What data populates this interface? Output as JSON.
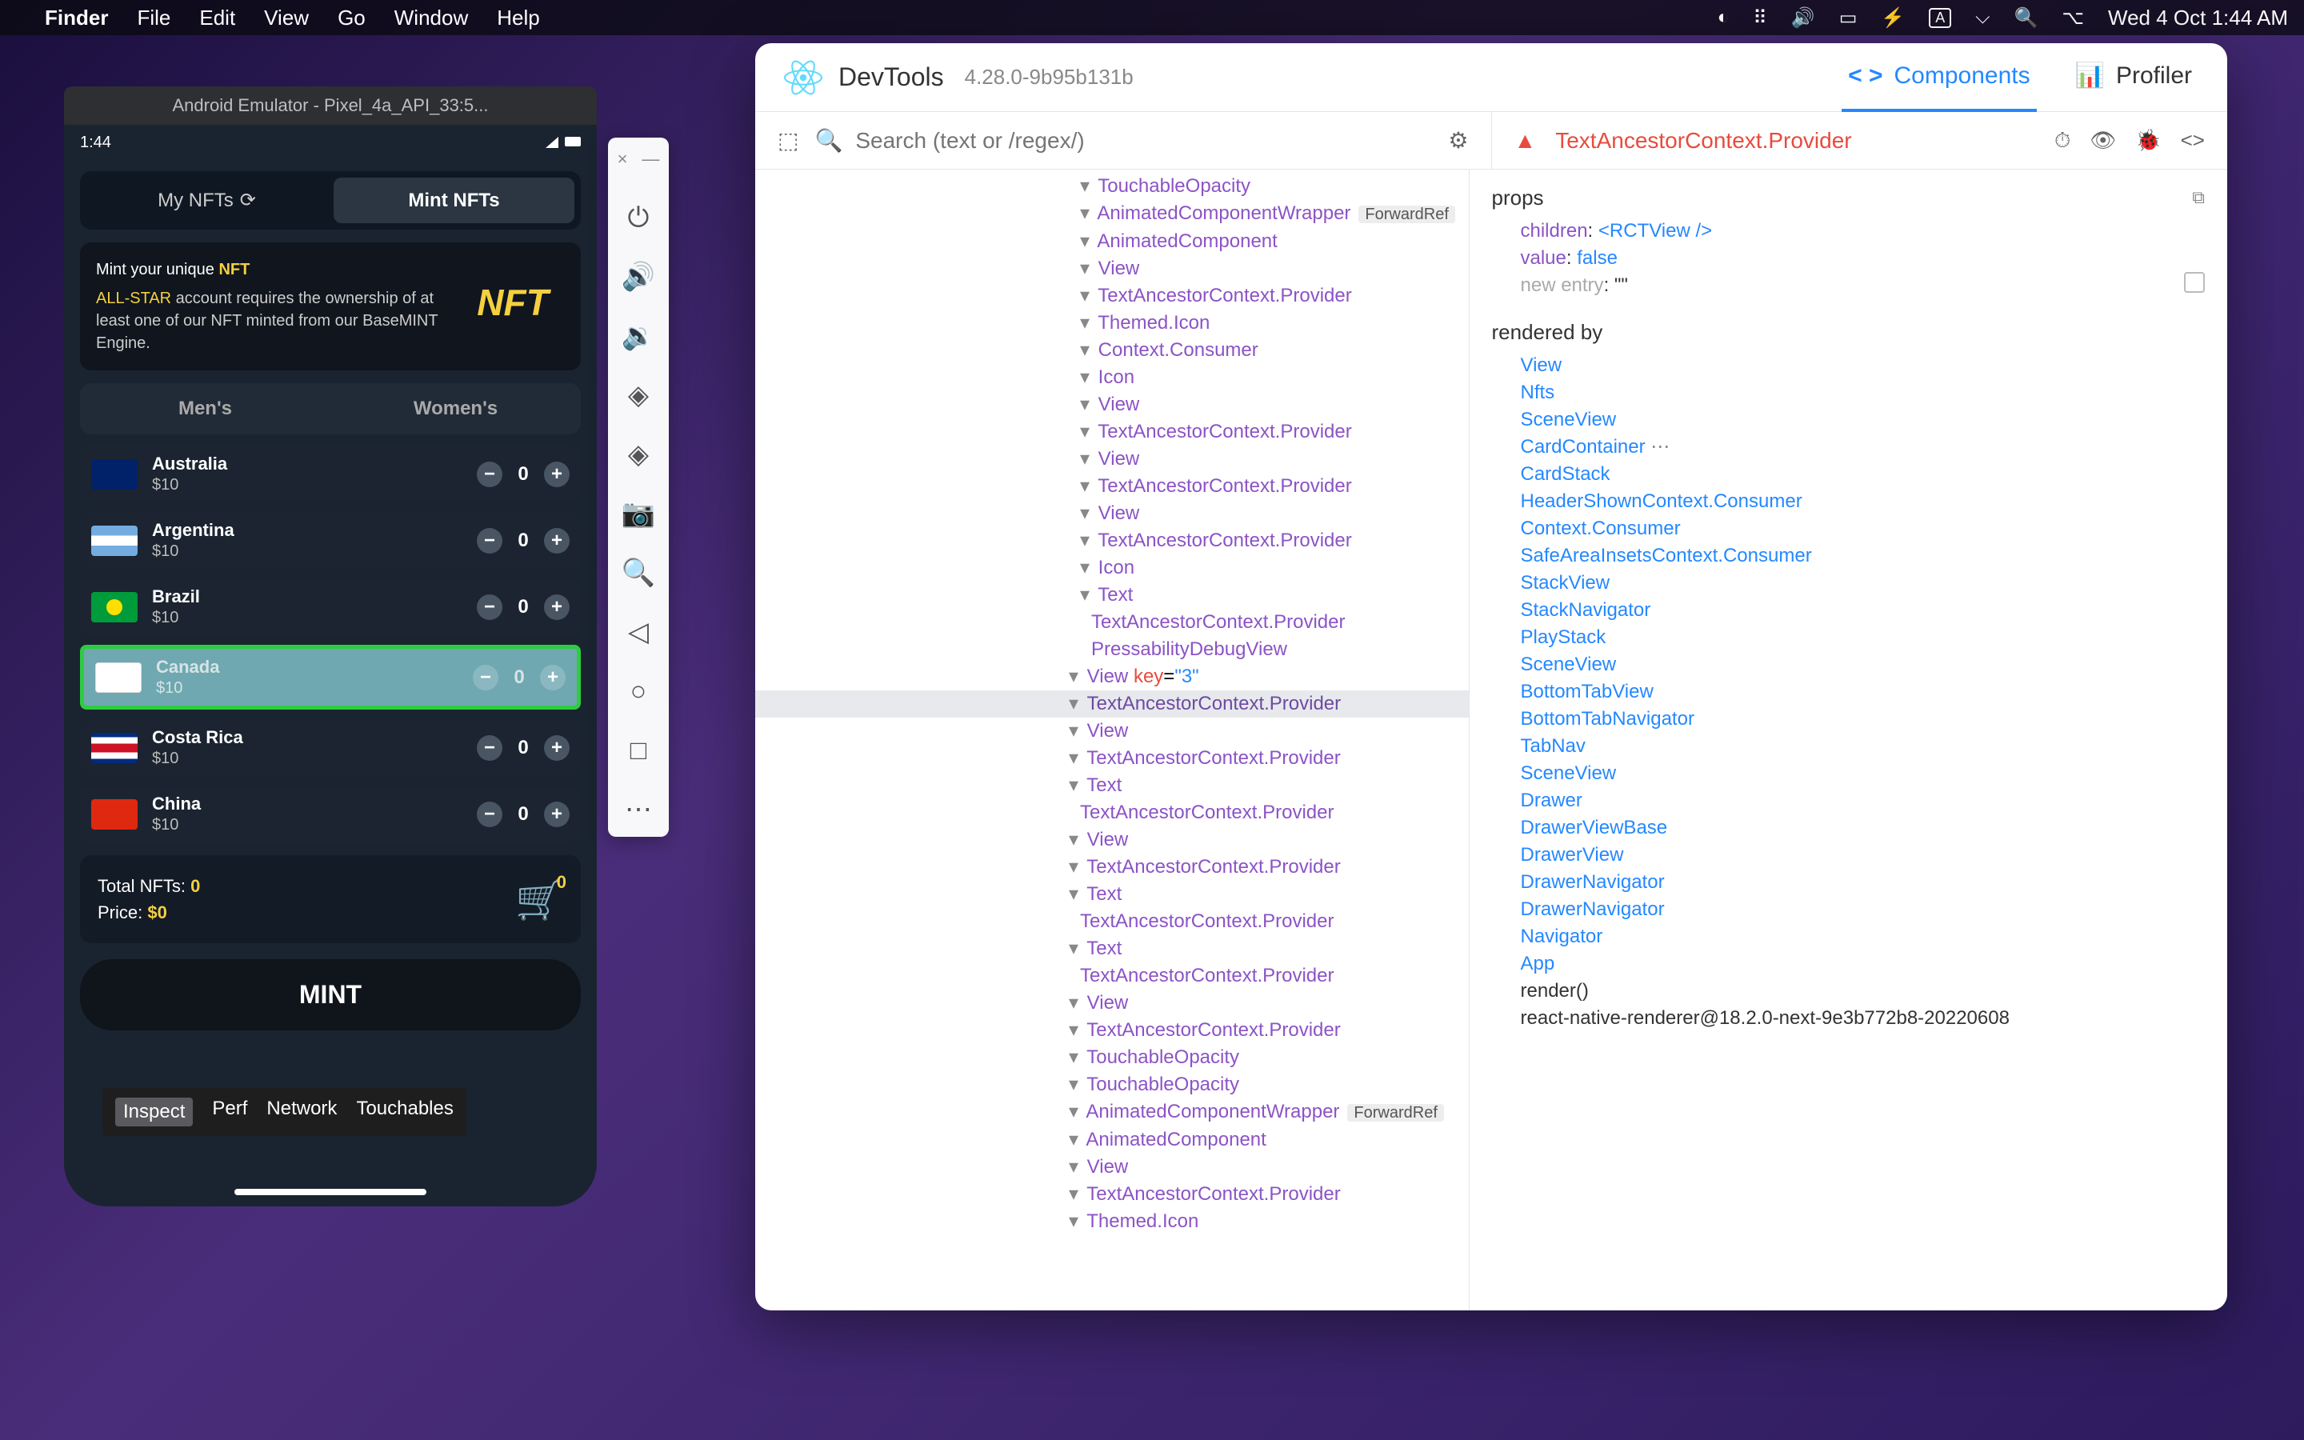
{
  "menubar": {
    "app": "Finder",
    "items": [
      "File",
      "Edit",
      "View",
      "Go",
      "Window",
      "Help"
    ],
    "clock": "Wed 4 Oct  1:44 AM"
  },
  "emulator": {
    "title": "Android Emulator - Pixel_4a_API_33:5...",
    "statusTime": "1:44",
    "tabs": {
      "myNfts": "My NFTs",
      "mintNfts": "Mint NFTs"
    },
    "mintInfo": {
      "head": "Mint your unique",
      "headHighlight": "NFT",
      "line2a": "ALL-STAR",
      "line2b": "account requires the ownership of at least one of our NFT minted from our BaseMINT Engine.",
      "badge": "NFT"
    },
    "gender": {
      "men": "Men's",
      "women": "Women's"
    },
    "countries": [
      {
        "name": "Australia",
        "price": "$10",
        "qty": "0",
        "flag": "flag-au"
      },
      {
        "name": "Argentina",
        "price": "$10",
        "qty": "0",
        "flag": "flag-ar"
      },
      {
        "name": "Brazil",
        "price": "$10",
        "qty": "0",
        "flag": "flag-br"
      },
      {
        "name": "Canada",
        "price": "$10",
        "qty": "0",
        "flag": "flag-ca",
        "selected": true
      },
      {
        "name": "Costa Rica",
        "price": "$10",
        "qty": "0",
        "flag": "flag-cr"
      },
      {
        "name": "China",
        "price": "$10",
        "qty": "0",
        "flag": "flag-cn"
      }
    ],
    "totals": {
      "totalLabel": "Total NFTs: ",
      "totalVal": "0",
      "priceLabel": "Price: ",
      "priceVal": "$0",
      "cartBadge": "0"
    },
    "mintButton": "MINT",
    "inspector": [
      "Inspect",
      "Perf",
      "Network",
      "Touchables"
    ]
  },
  "devtools": {
    "title": "DevTools",
    "version": "4.28.0-9b95b131b",
    "tabs": {
      "components": "Components",
      "profiler": "Profiler"
    },
    "searchPlaceholder": "Search (text or /regex/)",
    "selected": "TextAncestorContext.Provider",
    "tree": [
      {
        "indent": 9,
        "name": "TouchableOpacity"
      },
      {
        "indent": 9,
        "name": "AnimatedComponentWrapper",
        "fwd": "ForwardRef"
      },
      {
        "indent": 9,
        "name": "AnimatedComponent"
      },
      {
        "indent": 9,
        "name": "View"
      },
      {
        "indent": 9,
        "name": "TextAncestorContext.Provider"
      },
      {
        "indent": 9,
        "name": "Themed.Icon"
      },
      {
        "indent": 9,
        "name": "Context.Consumer"
      },
      {
        "indent": 9,
        "name": "Icon"
      },
      {
        "indent": 9,
        "name": "View"
      },
      {
        "indent": 9,
        "name": "TextAncestorContext.Provider"
      },
      {
        "indent": 9,
        "name": "View"
      },
      {
        "indent": 9,
        "name": "TextAncestorContext.Provider"
      },
      {
        "indent": 9,
        "name": "View"
      },
      {
        "indent": 9,
        "name": "TextAncestorContext.Provider"
      },
      {
        "indent": 9,
        "name": "Icon"
      },
      {
        "indent": 9,
        "name": "Text"
      },
      {
        "indent": 10,
        "name": "TextAncestorContext.Provider",
        "nocaret": true
      },
      {
        "indent": 10,
        "name": "PressabilityDebugView",
        "nocaret": true
      },
      {
        "indent": 8,
        "name": "View",
        "key": "3"
      },
      {
        "indent": 8,
        "name": "TextAncestorContext.Provider",
        "hl": true
      },
      {
        "indent": 8,
        "name": "View"
      },
      {
        "indent": 8,
        "name": "TextAncestorContext.Provider"
      },
      {
        "indent": 8,
        "name": "Text"
      },
      {
        "indent": 9,
        "name": "TextAncestorContext.Provider",
        "nocaret": true
      },
      {
        "indent": 8,
        "name": "View"
      },
      {
        "indent": 8,
        "name": "TextAncestorContext.Provider"
      },
      {
        "indent": 8,
        "name": "Text"
      },
      {
        "indent": 9,
        "name": "TextAncestorContext.Provider",
        "nocaret": true
      },
      {
        "indent": 8,
        "name": "Text"
      },
      {
        "indent": 9,
        "name": "TextAncestorContext.Provider",
        "nocaret": true
      },
      {
        "indent": 8,
        "name": "View"
      },
      {
        "indent": 8,
        "name": "TextAncestorContext.Provider"
      },
      {
        "indent": 8,
        "name": "TouchableOpacity"
      },
      {
        "indent": 8,
        "name": "TouchableOpacity"
      },
      {
        "indent": 8,
        "name": "AnimatedComponentWrapper",
        "fwd": "ForwardRef"
      },
      {
        "indent": 8,
        "name": "AnimatedComponent"
      },
      {
        "indent": 8,
        "name": "View"
      },
      {
        "indent": 8,
        "name": "TextAncestorContext.Provider"
      },
      {
        "indent": 8,
        "name": "Themed.Icon"
      }
    ],
    "props": {
      "heading": "props",
      "childrenKey": "children",
      "childrenVal": "<RCTView />",
      "valueKey": "value",
      "valueVal": "false",
      "newEntry": "new entry",
      "newEntryVal": "\"\""
    },
    "renderedBy": {
      "heading": "rendered by",
      "items": [
        "View",
        "Nfts",
        "SceneView",
        "CardContainer",
        "CardStack",
        "HeaderShownContext.Consumer",
        "Context.Consumer",
        "SafeAreaInsetsContext.Consumer",
        "StackView",
        "StackNavigator",
        "PlayStack",
        "SceneView",
        "BottomTabView",
        "BottomTabNavigator",
        "TabNav",
        "SceneView",
        "Drawer",
        "DrawerViewBase",
        "DrawerView",
        "DrawerNavigator",
        "DrawerNavigator",
        "Navigator",
        "App"
      ],
      "plain": [
        "render()",
        "react-native-renderer@18.2.0-next-9e3b772b8-20220608"
      ]
    }
  }
}
